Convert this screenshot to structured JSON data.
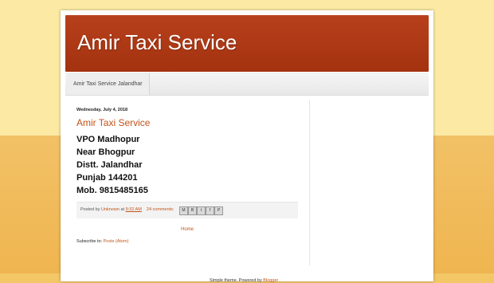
{
  "blog": {
    "title": "Amir Taxi Service"
  },
  "tabs": [
    {
      "label": "Amir Taxi Service Jalandhar"
    }
  ],
  "post": {
    "date": "Wednesday, July 4, 2018",
    "title": "Amir Taxi Service",
    "body_lines": [
      "VPO Madhopur",
      "Near Bhogpur",
      "Distt. Jalandhar",
      "Punjab 144201",
      "Mob. 9815485165"
    ],
    "footer": {
      "posted_by": "Posted by",
      "author": "Unknown",
      "at": "at",
      "time": "9:32 AM",
      "comments": "24 comments:"
    },
    "share_icons": [
      "email-icon",
      "blogthis-icon",
      "twitter-icon",
      "facebook-icon",
      "pinterest-icon"
    ]
  },
  "nav": {
    "home": "Home"
  },
  "subscribe": {
    "label": "Subscribe to:",
    "link": "Posts (Atom)"
  },
  "attribution": {
    "theme": "Simple theme. Powered by",
    "link": "Blogger"
  },
  "colors": {
    "header": "#b03a17",
    "link": "#c35317",
    "background": "#f3c766"
  }
}
